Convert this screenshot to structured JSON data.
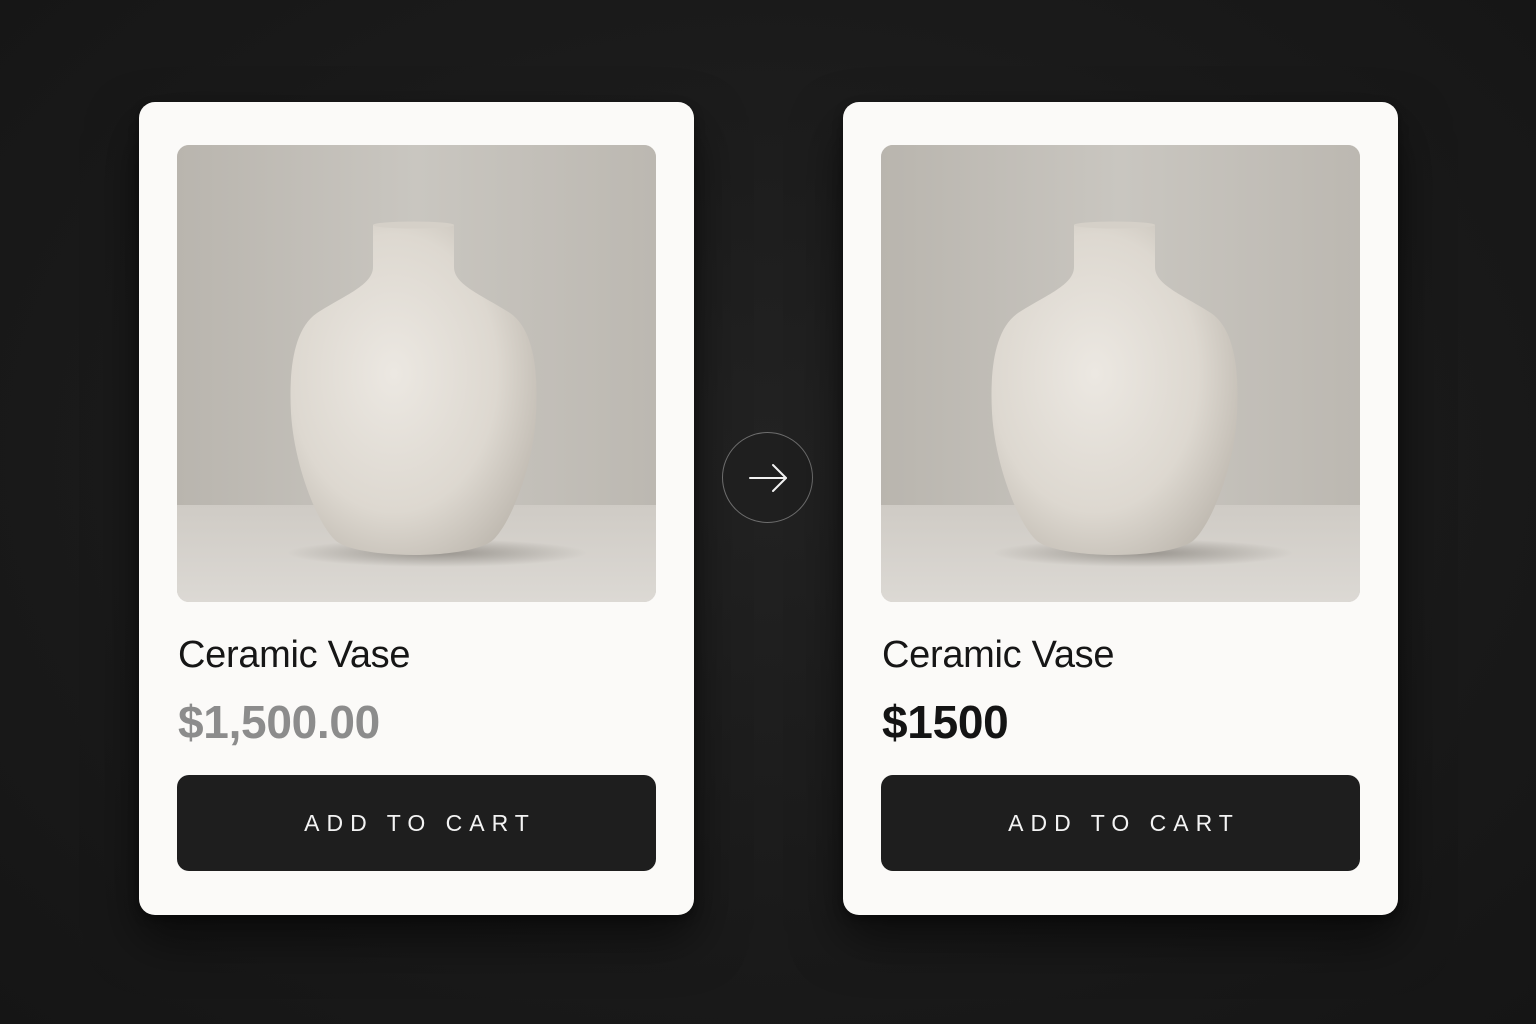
{
  "cards": [
    {
      "title": "Ceramic Vase",
      "price": "$1,500.00",
      "button_label": "ADD TO CART",
      "price_color": "#8c8c8c"
    },
    {
      "title": "Ceramic Vase",
      "price": "$1500",
      "button_label": "ADD TO CART",
      "price_color": "#141414"
    }
  ],
  "transition_icon": "arrow-right-icon",
  "colors": {
    "background": "#1b1b1b",
    "card": "#fbfaf8",
    "button": "#1e1e1e",
    "button_text": "#f3f3f3"
  }
}
